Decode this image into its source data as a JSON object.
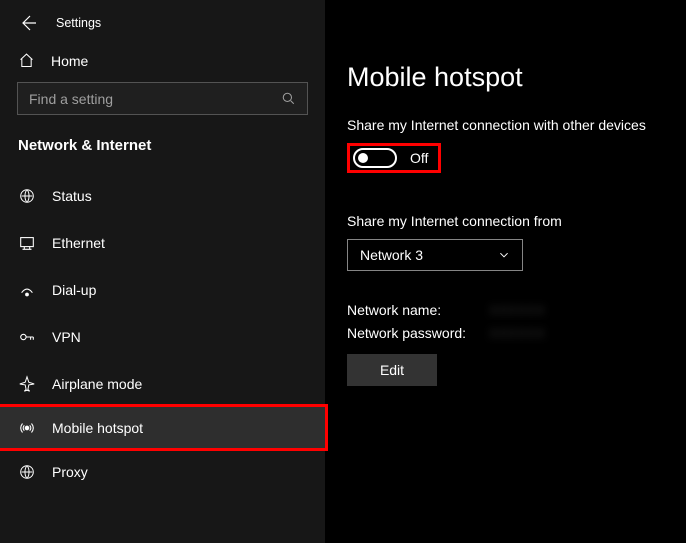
{
  "header": {
    "title": "Settings"
  },
  "home": {
    "label": "Home"
  },
  "search": {
    "placeholder": "Find a setting"
  },
  "section_title": "Network & Internet",
  "nav": [
    {
      "label": "Status"
    },
    {
      "label": "Ethernet"
    },
    {
      "label": "Dial-up"
    },
    {
      "label": "VPN"
    },
    {
      "label": "Airplane mode"
    },
    {
      "label": "Mobile hotspot"
    },
    {
      "label": "Proxy"
    }
  ],
  "page": {
    "title": "Mobile hotspot",
    "share_label": "Share my Internet connection with other devices",
    "toggle_state": "Off",
    "share_from_label": "Share my Internet connection from",
    "dropdown_selected": "Network 3",
    "network_name_label": "Network name:",
    "network_name_value": "XXXXXX",
    "network_password_label": "Network password:",
    "network_password_value": "XXXXXX",
    "edit_label": "Edit"
  }
}
